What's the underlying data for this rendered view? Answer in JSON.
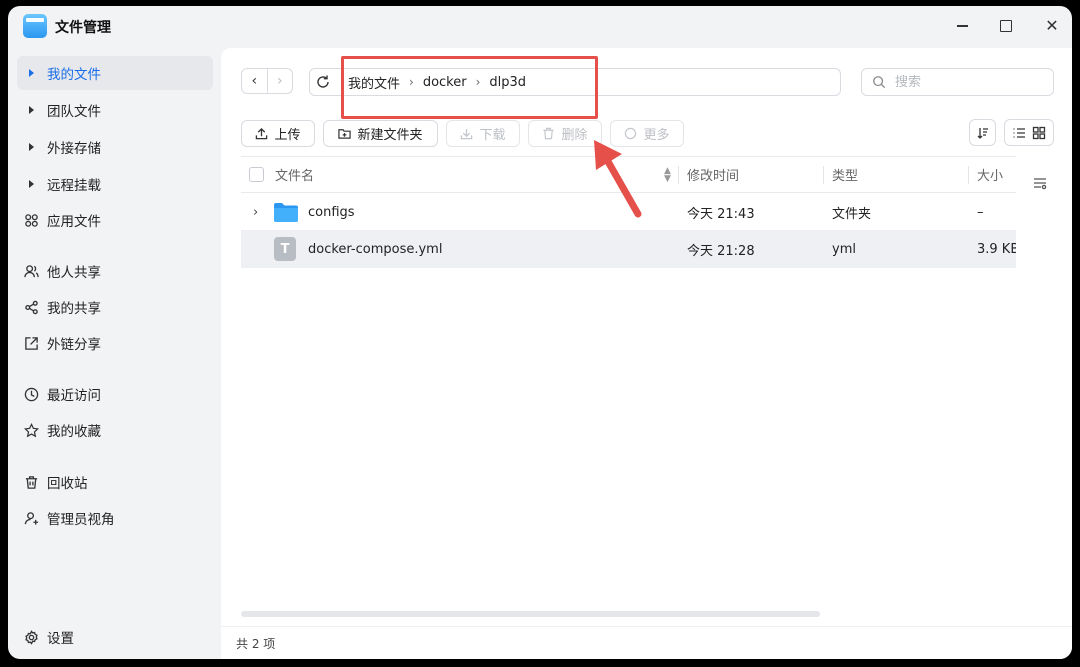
{
  "window": {
    "title": "文件管理"
  },
  "sidebar": {
    "items": [
      {
        "label": "我的文件",
        "icon": "caret-right-icon",
        "active": true
      },
      {
        "label": "团队文件",
        "icon": "caret-right-icon"
      },
      {
        "label": "外接存储",
        "icon": "caret-right-icon"
      },
      {
        "label": "远程挂载",
        "icon": "caret-right-icon"
      },
      {
        "label": "应用文件",
        "icon": "apps-icon"
      },
      {
        "label": "他人共享",
        "icon": "users-icon"
      },
      {
        "label": "我的共享",
        "icon": "share-icon"
      },
      {
        "label": "外链分享",
        "icon": "external-link-icon"
      },
      {
        "label": "最近访问",
        "icon": "clock-icon"
      },
      {
        "label": "我的收藏",
        "icon": "star-icon"
      },
      {
        "label": "回收站",
        "icon": "trash-icon"
      },
      {
        "label": "管理员视角",
        "icon": "admin-user-icon"
      }
    ],
    "settings_label": "设置"
  },
  "path": {
    "crumbs": [
      "我的文件",
      "docker",
      "dlp3d"
    ]
  },
  "search": {
    "placeholder": "搜索"
  },
  "toolbar": {
    "upload": "上传",
    "new_folder": "新建文件夹",
    "download": "下载",
    "delete": "删除",
    "more": "更多"
  },
  "table": {
    "columns": [
      "文件名",
      "修改时间",
      "类型",
      "大小"
    ],
    "rows": [
      {
        "name": "configs",
        "modified": "今天 21:43",
        "type": "文件夹",
        "size": "–",
        "kind": "folder"
      },
      {
        "name": "docker-compose.yml",
        "modified": "今天 21:28",
        "type": "yml",
        "size": "3.9 KB",
        "kind": "file",
        "selected": true
      }
    ]
  },
  "footer": {
    "count": "共 2 项"
  },
  "colors": {
    "accent": "#1a6ee8",
    "highlight": "#e5504a",
    "folder": "#2a98f0"
  }
}
